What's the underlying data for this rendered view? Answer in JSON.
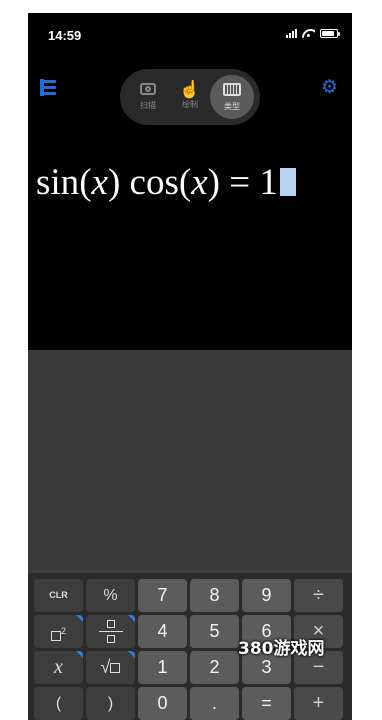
{
  "status_bar": {
    "time": "14:59",
    "battery_level": 0.85
  },
  "mode_switch": {
    "items": [
      {
        "icon": "camera-icon",
        "label": "扫描"
      },
      {
        "icon": "hand-icon",
        "label": "绘制"
      },
      {
        "icon": "keyboard-icon",
        "label": "类型"
      }
    ],
    "active": "类型"
  },
  "toolbar": {
    "menu_icon": "menu-icon",
    "settings_icon": "gear-icon"
  },
  "formula": {
    "fn1": "sin",
    "lp1": "(",
    "var1": "x",
    "rp1": ")",
    "fn2": "cos",
    "lp2": "(",
    "var2": "x",
    "rp2": ")",
    "eq": "=",
    "rhs": "1"
  },
  "keypad": {
    "row1": [
      "CLR",
      "%",
      "7",
      "8",
      "9",
      "÷"
    ],
    "row2": [
      "□²",
      "□/□",
      "4",
      "5",
      "6",
      "×"
    ],
    "row3": [
      "x",
      "√□",
      "1",
      "2",
      "3",
      "−"
    ],
    "row4": [
      "(",
      ")",
      "0",
      ".",
      "=",
      "+"
    ]
  },
  "watermark": "380游戏网"
}
